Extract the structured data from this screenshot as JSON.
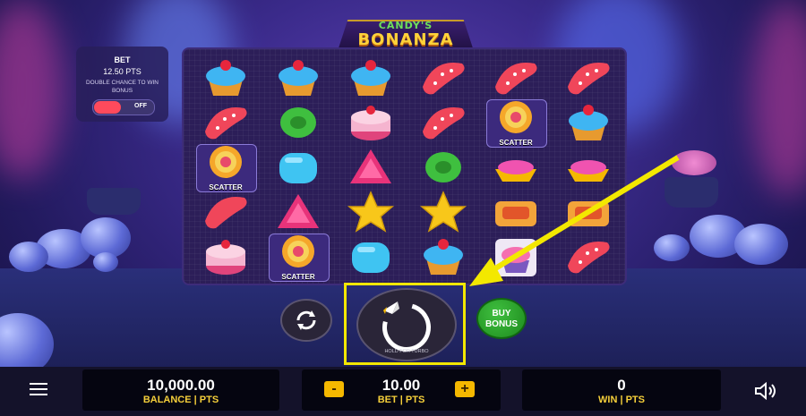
{
  "logo": {
    "line1": "CANDY'S",
    "line2": "BONANZA"
  },
  "bet_panel": {
    "title": "BET",
    "amount": "12.50 PTS",
    "description": "DOUBLE CHANCE TO WIN BONUS",
    "toggle_label": "OFF"
  },
  "reels": {
    "scatter_label": "SCATTER",
    "grid": [
      [
        "cupcake",
        "jelly",
        "cake",
        "candy-red",
        "cake"
      ],
      [
        "cupcake",
        "green-candy",
        "blue-candy",
        "triangle",
        "lollipop"
      ],
      [
        "cupcake",
        "cake",
        "triangle",
        "star",
        "blue-candy"
      ],
      [
        "jelly",
        "jelly",
        "green-candy",
        "star",
        "cupcake"
      ],
      [
        "jelly",
        "lollipop",
        "pink-bowl",
        "pie",
        "pink-cupcake"
      ],
      [
        "jelly",
        "cupcake",
        "pink-bowl",
        "pie",
        "jelly"
      ]
    ],
    "scatter_positions": [
      "0-2",
      "1-4",
      "4-1"
    ]
  },
  "controls": {
    "hold_text": "HOLD FOR TURBO",
    "buy_bonus_line1": "BUY",
    "buy_bonus_line2": "BONUS"
  },
  "bottom_bar": {
    "balance_value": "10,000.00",
    "balance_label": "BALANCE | PTS",
    "bet_value": "10.00",
    "bet_label": "BET | PTS",
    "minus": "-",
    "plus": "+",
    "win_value": "0",
    "win_label": "WIN | PTS"
  },
  "colors": {
    "accent_yellow": "#f3e800",
    "label_gold": "#f5cf3a",
    "buy_green": "#2aa52a",
    "toggle_red": "#ff4a5c"
  }
}
